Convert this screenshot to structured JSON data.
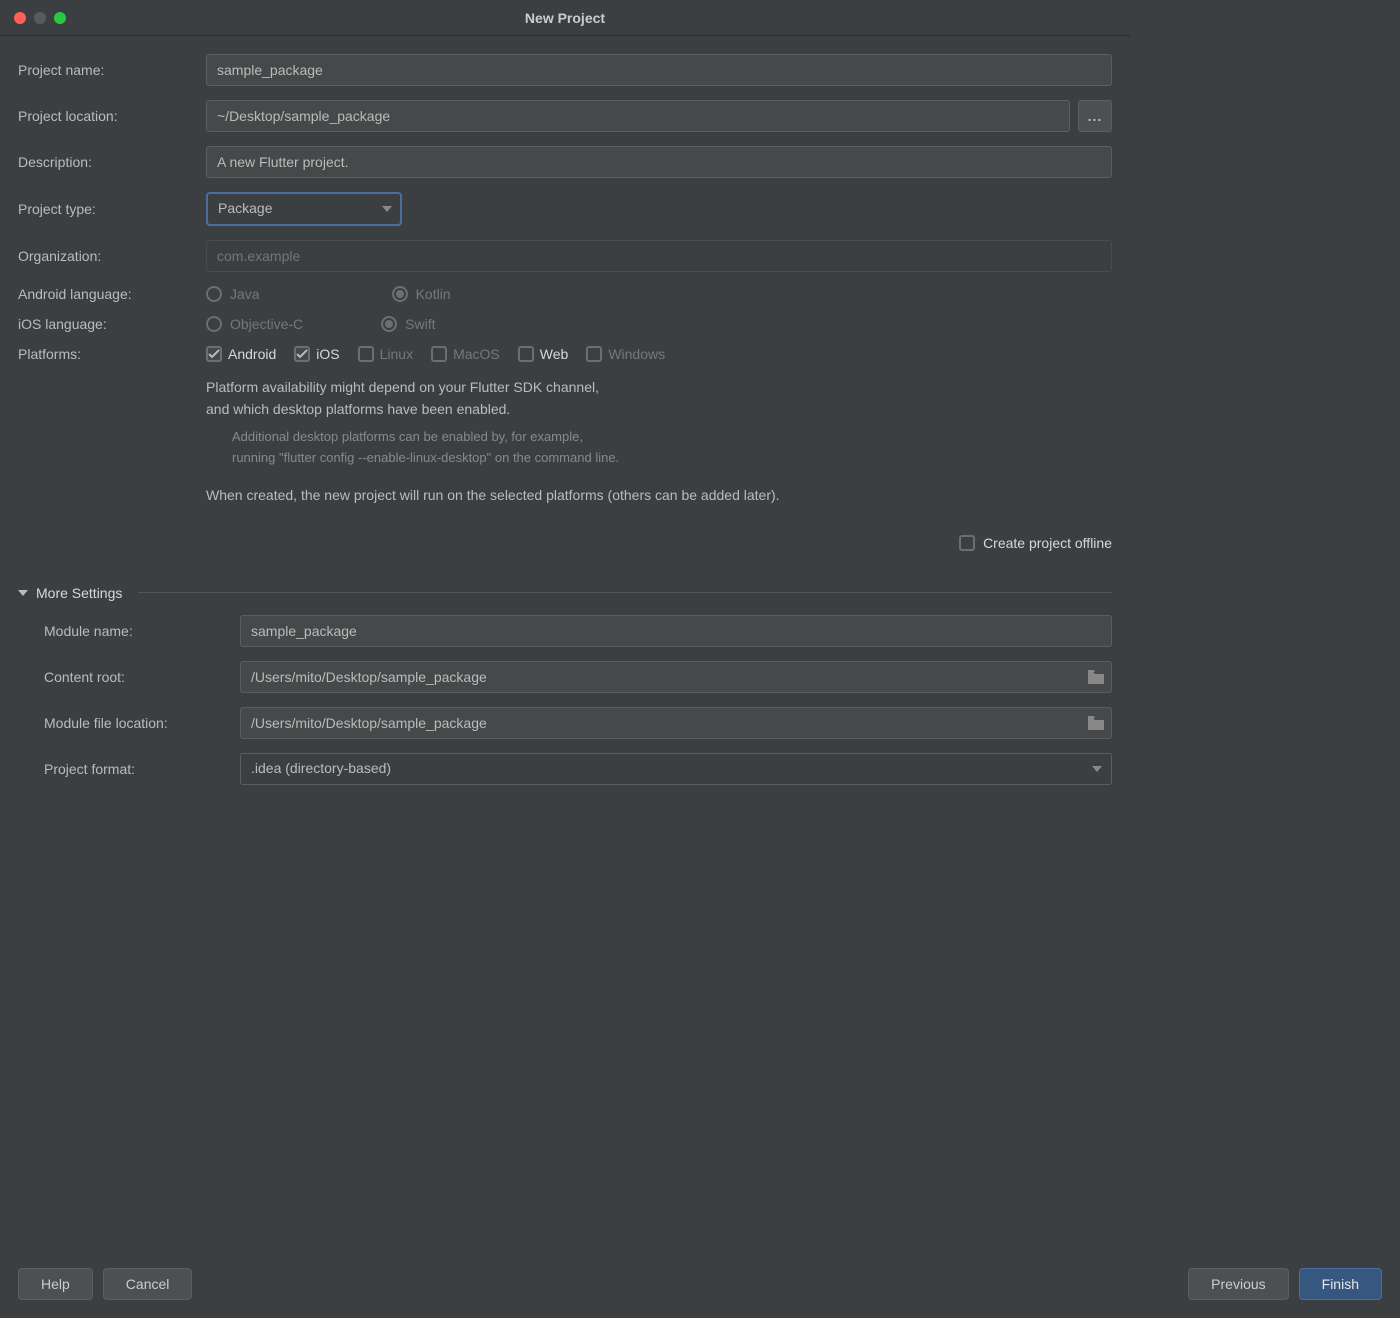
{
  "window": {
    "title": "New Project"
  },
  "labels": {
    "project_name": "Project name:",
    "project_location": "Project location:",
    "description": "Description:",
    "project_type": "Project type:",
    "organization": "Organization:",
    "android_language": "Android language:",
    "ios_language": "iOS language:",
    "platforms": "Platforms:",
    "more_settings": "More Settings",
    "module_name": "Module name:",
    "content_root": "Content root:",
    "module_file_location": "Module file location:",
    "project_format": "Project format:",
    "create_offline": "Create project offline"
  },
  "values": {
    "project_name": "sample_package",
    "project_location": "~/Desktop/sample_package",
    "description": "A new Flutter project.",
    "project_type": "Package",
    "organization_placeholder": "com.example",
    "module_name": "sample_package",
    "content_root": "/Users/mito/Desktop/sample_package",
    "module_file_location": "/Users/mito/Desktop/sample_package",
    "project_format": ".idea (directory-based)"
  },
  "android_language": {
    "options": [
      "Java",
      "Kotlin"
    ],
    "selected": "Kotlin"
  },
  "ios_language": {
    "options": [
      "Objective-C",
      "Swift"
    ],
    "selected": "Swift"
  },
  "platforms": [
    {
      "label": "Android",
      "checked": true,
      "bright": true
    },
    {
      "label": "iOS",
      "checked": true,
      "bright": true
    },
    {
      "label": "Linux",
      "checked": false,
      "bright": false
    },
    {
      "label": "MacOS",
      "checked": false,
      "bright": false
    },
    {
      "label": "Web",
      "checked": false,
      "bright": true
    },
    {
      "label": "Windows",
      "checked": false,
      "bright": false
    }
  ],
  "info": {
    "line1": "Platform availability might depend on your Flutter SDK channel,",
    "line2": "and which desktop platforms have been enabled.",
    "sub1": "Additional desktop platforms can be enabled by, for example,",
    "sub2": "running \"flutter config --enable-linux-desktop\" on the command line.",
    "line3": "When created, the new project will run on the selected platforms (others can be added later)."
  },
  "buttons": {
    "help": "Help",
    "cancel": "Cancel",
    "previous": "Previous",
    "finish": "Finish",
    "browse": "..."
  }
}
